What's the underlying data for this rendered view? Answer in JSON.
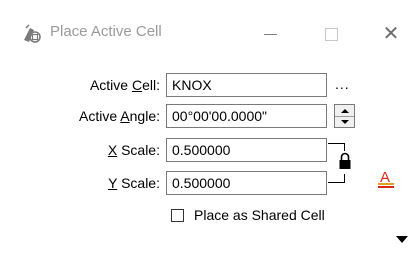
{
  "window": {
    "title": "Place Active Cell",
    "app_icon": "cell-placement-icon"
  },
  "window_controls": {
    "minimize": "minimize-icon",
    "maximize": "maximize-icon",
    "close_glyph": "✕"
  },
  "form": {
    "active_cell": {
      "label_pre": "Active ",
      "label_key": "C",
      "label_post": "ell:",
      "value": "KNOX",
      "browse_label": "..."
    },
    "active_angle": {
      "label_pre": "Active ",
      "label_key": "A",
      "label_post": "ngle:",
      "value": "00°00'00.0000\""
    },
    "x_scale": {
      "label_key": "X",
      "label_post": " Scale:",
      "value": "0.500000"
    },
    "y_scale": {
      "label_key": "Y",
      "label_post": " Scale:",
      "value": "0.500000"
    },
    "shared_cell": {
      "label": "Place as Shared Cell",
      "checked": false
    }
  },
  "icons": {
    "scale_lock": "lock-icon",
    "text_style": "text-style-icon",
    "expand": "expand-arrow-icon"
  },
  "colors": {
    "font_icon_red": "#d9261c",
    "font_icon_orange": "#e0a020"
  }
}
